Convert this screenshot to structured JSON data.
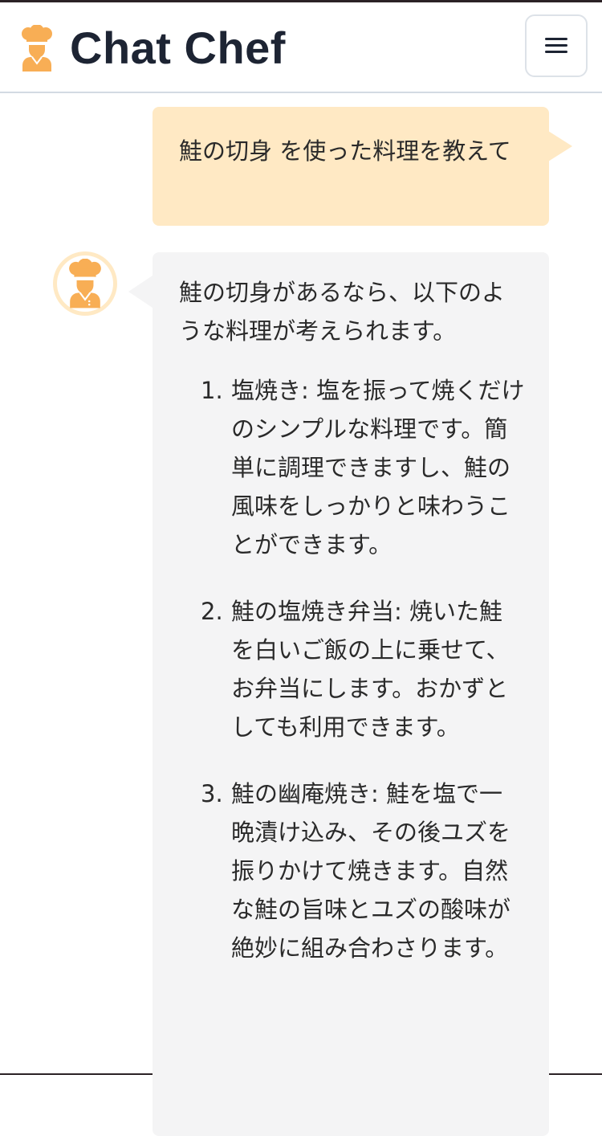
{
  "header": {
    "app_title": "Chat Chef",
    "brand_icon": "chef-icon",
    "menu_icon": "hamburger-menu-icon"
  },
  "conversation": {
    "user_message": "鮭の切身 を使った料理を教えて",
    "assistant_avatar_icon": "chef-icon",
    "assistant_intro": "鮭の切身があるなら、以下のような料理が考えられます。",
    "recipes": [
      {
        "number": "1.",
        "text": "塩焼き: 塩を振って焼くだけのシンプルな料理です。簡単に調理できますし、鮭の風味をしっかりと味わうことができます。"
      },
      {
        "number": "2.",
        "text": "鮭の塩焼き弁当: 焼いた鮭を白いご飯の上に乗せて、お弁当にします。おかずとしても利用できます。"
      },
      {
        "number": "3.",
        "text": "鮭の幽庵焼き: 鮭を塩で一晩漬け込み、その後ユズを振りかけて焼きます。自然な鮭の旨味とユズの酸味が絶妙に組み合わさります。"
      }
    ]
  },
  "colors": {
    "brand_orange": "#f8ae55",
    "user_bubble": "#ffe9c4",
    "assistant_bubble": "#f4f4f5",
    "title_text": "#1d2433"
  }
}
